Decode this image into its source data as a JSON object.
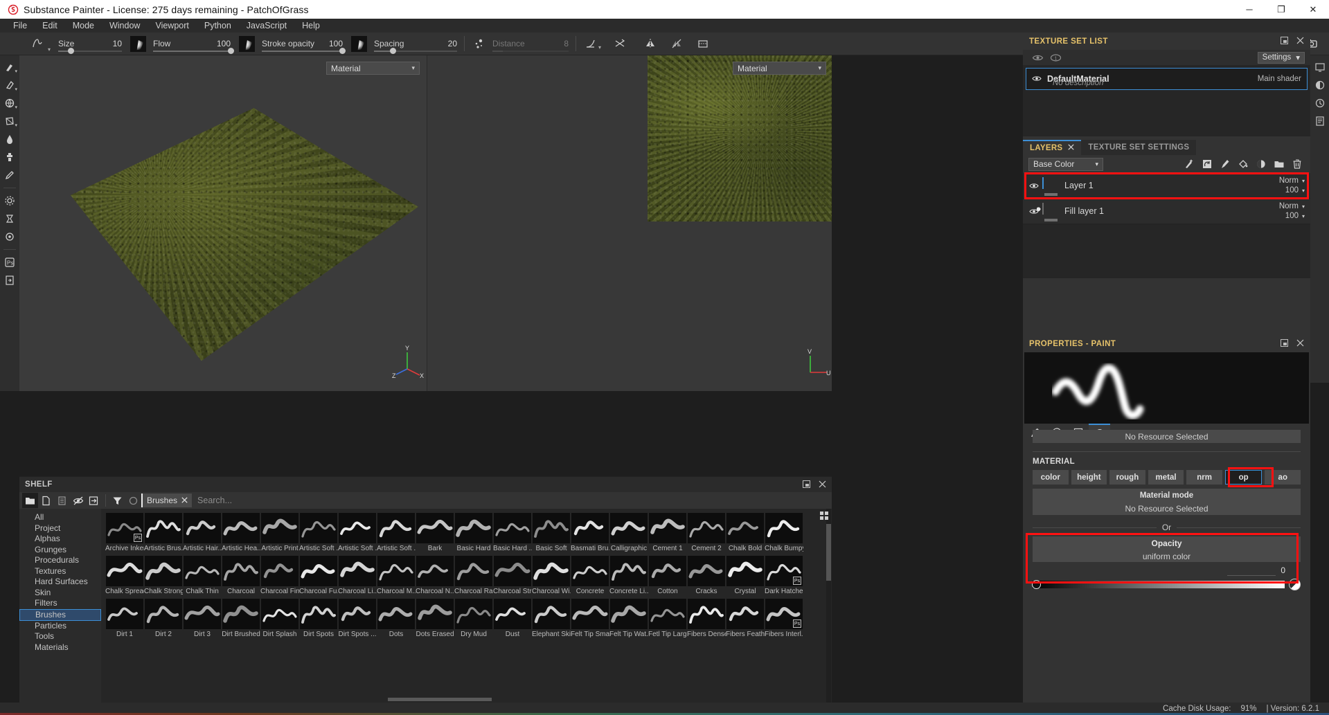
{
  "window": {
    "title": "Substance Painter - License: 275 days remaining - PatchOfGrass",
    "logo_icon": "substance-painter-logo-icon",
    "minimize": "─",
    "maximize": "❐",
    "close": "✕"
  },
  "menubar": {
    "items": [
      "File",
      "Edit",
      "Mode",
      "Window",
      "Viewport",
      "Python",
      "JavaScript",
      "Help"
    ]
  },
  "toolbar": {
    "brush_tool_icon": "brush-preset-icon",
    "params": [
      {
        "label": "Size",
        "value": "10",
        "fill_pct": 18
      },
      {
        "label": "Flow",
        "value": "100",
        "fill_pct": 100
      },
      {
        "label": "Stroke opacity",
        "value": "100",
        "fill_pct": 100
      },
      {
        "label": "Spacing",
        "value": "20",
        "fill_pct": 22
      },
      {
        "label": "Distance",
        "value": "8",
        "fill_pct": 14,
        "disabled": true
      }
    ],
    "alpha_icon": "alpha-thumbnail-icon",
    "right_icons": [
      "angle-tool-icon",
      "shuffle-icon",
      "symmetry-plane-icon",
      "symmetry-off-icon",
      "transform-icon"
    ],
    "view_icons": [
      "pause-icon",
      "2d-3d-view-icon",
      "3d-view-icon",
      "camera-view-icon",
      "screenshot-icon"
    ]
  },
  "left_rail": {
    "items": [
      "paint-brush-icon",
      "eraser-icon",
      "projection-icon",
      "polygon-fill-icon",
      "smudge-icon",
      "clone-stamp-icon",
      "material-picker-icon",
      "settings-gear-icon",
      "bake-icon",
      "render-icon",
      "photoshop-export-icon",
      "export-textures-icon"
    ]
  },
  "right_rail": {
    "items": [
      "display-settings-icon",
      "shader-settings-icon",
      "history-icon",
      "log-icon"
    ]
  },
  "viewport": {
    "view3d_combo": "Material",
    "view2d_combo": "Material",
    "axis_labels": [
      "X",
      "Y",
      "Z",
      "U",
      "V"
    ]
  },
  "texture_set_list": {
    "panel_title": "TEXTURE SET LIST",
    "float_icon": "undock-icon",
    "close_icon": "close-icon",
    "toolbar_icons": [
      "visibility-toggle-icon",
      "solo-toggle-icon"
    ],
    "settings_label": "Settings",
    "items": [
      {
        "name": "DefaultMaterial",
        "description": "No description",
        "shader": "Main shader",
        "visible": true
      }
    ]
  },
  "layers_panel": {
    "tabs": [
      {
        "label": "LAYERS",
        "active": true,
        "closeable": true
      },
      {
        "label": "TEXTURE SET SETTINGS",
        "active": false,
        "closeable": false
      }
    ],
    "channel_selector": "Base Color",
    "toolbar_icons": [
      "add-effect-icon",
      "add-smart-material-icon",
      "add-paint-layer-icon",
      "add-fill-layer-icon",
      "add-mask-icon",
      "add-folder-icon",
      "delete-layer-icon"
    ],
    "layers": [
      {
        "name": "Layer 1",
        "blend": "Norm",
        "opacity": "100",
        "thumb": "checker",
        "visible": true,
        "selected": true,
        "highlighted": true
      },
      {
        "name": "Fill layer 1",
        "blend": "Norm",
        "opacity": "100",
        "thumb": "fill",
        "visible": true,
        "selected": false,
        "highlighted": false
      }
    ]
  },
  "properties_panel": {
    "panel_title": "PROPERTIES - PAINT",
    "float_icon": "undock-icon",
    "close_icon": "close-icon",
    "tabs": [
      {
        "icon": "brush-stroke-icon",
        "active": false
      },
      {
        "icon": "alpha-checker-icon",
        "active": false
      },
      {
        "icon": "stencil-icon",
        "active": false
      },
      {
        "icon": "material-sphere-icon",
        "active": true
      }
    ],
    "resource_bar": "No Resource Selected",
    "material_section_title": "MATERIAL",
    "channels": [
      {
        "label": "color",
        "active": false
      },
      {
        "label": "height",
        "active": false
      },
      {
        "label": "rough",
        "active": false
      },
      {
        "label": "metal",
        "active": false
      },
      {
        "label": "nrm",
        "active": false
      },
      {
        "label": "op",
        "active": true,
        "highlighted": true
      },
      {
        "label": "ao",
        "active": false
      }
    ],
    "material_mode_label": "Material mode",
    "material_mode_value": "No Resource Selected",
    "or_label": "Or",
    "opacity": {
      "title": "Opacity",
      "subtitle": "uniform color",
      "value": "0",
      "slider_pct": 0,
      "highlighted": true
    }
  },
  "shelf": {
    "panel_title": "SHELF",
    "float_icon": "undock-icon",
    "close_icon": "close-icon",
    "toolbar_icons": [
      "folder-icon",
      "new-file-icon",
      "save-icon",
      "hide-icon",
      "import-icon",
      "filter-funnel-icon",
      "circle-icon"
    ],
    "filter_chip": "Brushes",
    "filter_chip_close": "close-icon",
    "search_placeholder": "Search...",
    "grid_view_icon": "grid-view-icon",
    "categories": [
      {
        "label": "All",
        "selected": false
      },
      {
        "label": "Project",
        "selected": false
      },
      {
        "label": "Alphas",
        "selected": false
      },
      {
        "label": "Grunges",
        "selected": false
      },
      {
        "label": "Procedurals",
        "selected": false
      },
      {
        "label": "Textures",
        "selected": false
      },
      {
        "label": "Hard Surfaces",
        "selected": false
      },
      {
        "label": "Skin",
        "selected": false
      },
      {
        "label": "Filters",
        "selected": false
      },
      {
        "label": "Brushes",
        "selected": true
      },
      {
        "label": "Particles",
        "selected": false
      },
      {
        "label": "Tools",
        "selected": false
      },
      {
        "label": "Materials",
        "selected": false
      }
    ],
    "brushes": [
      {
        "name": "Archive Inker",
        "ps": true
      },
      {
        "name": "Artistic Brus...",
        "ps": false
      },
      {
        "name": "Artistic Hair...",
        "ps": false
      },
      {
        "name": "Artistic Hea...",
        "ps": false
      },
      {
        "name": "Artistic Print",
        "ps": false
      },
      {
        "name": "Artistic Soft ...",
        "ps": false
      },
      {
        "name": "Artistic Soft ...",
        "ps": false
      },
      {
        "name": "Artistic Soft ...",
        "ps": false
      },
      {
        "name": "Bark",
        "ps": false
      },
      {
        "name": "Basic Hard",
        "ps": false
      },
      {
        "name": "Basic Hard ...",
        "ps": false
      },
      {
        "name": "Basic Soft",
        "ps": false
      },
      {
        "name": "Basmati Bru...",
        "ps": false
      },
      {
        "name": "Calligraphic",
        "ps": false
      },
      {
        "name": "Cement 1",
        "ps": false
      },
      {
        "name": "Cement 2",
        "ps": false
      },
      {
        "name": "Chalk Bold",
        "ps": false
      },
      {
        "name": "Chalk Bumpy",
        "ps": false
      },
      {
        "name": "Chalk Spread",
        "ps": false
      },
      {
        "name": "Chalk Strong",
        "ps": false
      },
      {
        "name": "Chalk Thin",
        "ps": false
      },
      {
        "name": "Charcoal",
        "ps": false
      },
      {
        "name": "Charcoal Fine",
        "ps": false
      },
      {
        "name": "Charcoal Fu...",
        "ps": false
      },
      {
        "name": "Charcoal Li...",
        "ps": false
      },
      {
        "name": "Charcoal M...",
        "ps": false
      },
      {
        "name": "Charcoal N...",
        "ps": false
      },
      {
        "name": "Charcoal Ra...",
        "ps": false
      },
      {
        "name": "Charcoal Str...",
        "ps": false
      },
      {
        "name": "Charcoal Wi...",
        "ps": false
      },
      {
        "name": "Concrete",
        "ps": false
      },
      {
        "name": "Concrete Li...",
        "ps": false
      },
      {
        "name": "Cotton",
        "ps": false
      },
      {
        "name": "Cracks",
        "ps": false
      },
      {
        "name": "Crystal",
        "ps": false
      },
      {
        "name": "Dark Hatcher",
        "ps": true
      },
      {
        "name": "Dirt 1",
        "ps": false
      },
      {
        "name": "Dirt 2",
        "ps": false
      },
      {
        "name": "Dirt 3",
        "ps": false
      },
      {
        "name": "Dirt Brushed",
        "ps": false
      },
      {
        "name": "Dirt Splash",
        "ps": false
      },
      {
        "name": "Dirt Spots",
        "ps": false
      },
      {
        "name": "Dirt Spots ...",
        "ps": false
      },
      {
        "name": "Dots",
        "ps": false
      },
      {
        "name": "Dots Erased",
        "ps": false
      },
      {
        "name": "Dry Mud",
        "ps": false
      },
      {
        "name": "Dust",
        "ps": false
      },
      {
        "name": "Elephant Skin",
        "ps": false
      },
      {
        "name": "Felt Tip Small",
        "ps": false
      },
      {
        "name": "Felt Tip Wat...",
        "ps": false
      },
      {
        "name": "Fetl Tip Large",
        "ps": false
      },
      {
        "name": "Fibers Dense",
        "ps": false
      },
      {
        "name": "Fibers Feather",
        "ps": false
      },
      {
        "name": "Fibers Interl...",
        "ps": true
      }
    ]
  },
  "statusbar": {
    "cache_label": "Cache Disk Usage:",
    "cache_value": "91%",
    "version": "| Version: 6.2.1"
  },
  "colors": {
    "accent_blue": "#3d8fd6",
    "highlight_red": "#ff1111",
    "panel_bg": "#333333",
    "list_bg": "#262626",
    "tab_gold": "#e6c26a"
  }
}
